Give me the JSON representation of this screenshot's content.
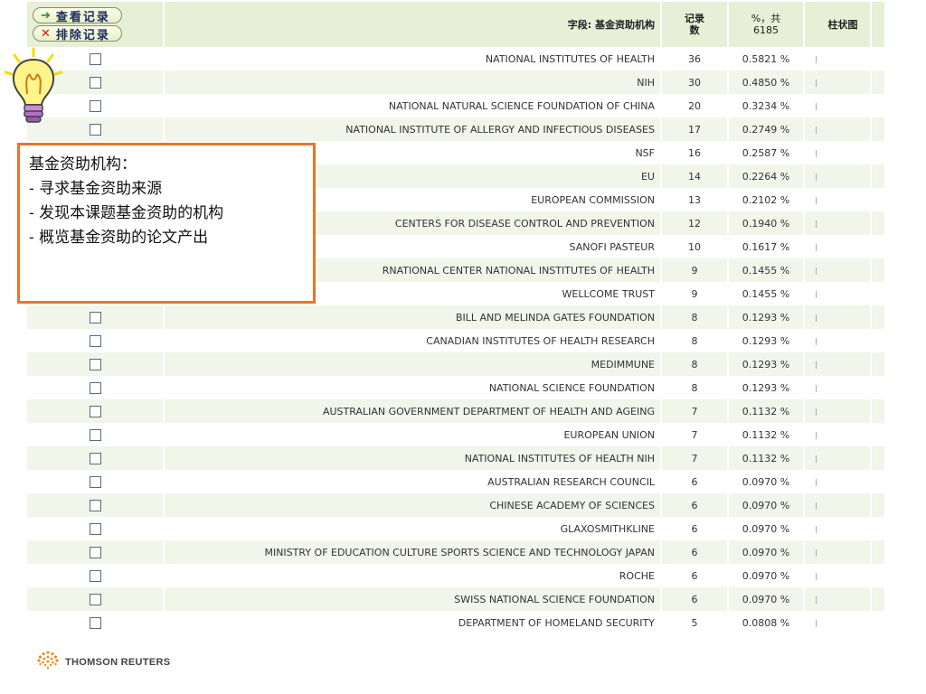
{
  "toolbar": {
    "view_records_label": "查看记录",
    "exclude_records_label": "排除记录",
    "view_icon": "arrow-right-icon",
    "exclude_icon": "x-icon"
  },
  "table": {
    "headers": {
      "field": "字段: 基金资助机构",
      "count_line1": "记录",
      "count_line2": "数",
      "percent_line1": "%，共",
      "percent_line2": "6185",
      "barchart": "柱状图"
    },
    "rows": [
      {
        "name": "NATIONAL INSTITUTES OF HEALTH",
        "count": "36",
        "percent": "0.5821 %"
      },
      {
        "name": "NIH",
        "count": "30",
        "percent": "0.4850 %"
      },
      {
        "name": "NATIONAL NATURAL SCIENCE FOUNDATION OF CHINA",
        "count": "20",
        "percent": "0.3234 %"
      },
      {
        "name": "NATIONAL INSTITUTE OF ALLERGY AND INFECTIOUS DISEASES",
        "count": "17",
        "percent": "0.2749 %"
      },
      {
        "name": "NSF",
        "count": "16",
        "percent": "0.2587 %"
      },
      {
        "name": "EU",
        "count": "14",
        "percent": "0.2264 %"
      },
      {
        "name": "EUROPEAN COMMISSION",
        "count": "13",
        "percent": "0.2102 %"
      },
      {
        "name": "CENTERS FOR DISEASE CONTROL AND PREVENTION",
        "count": "12",
        "percent": "0.1940 %"
      },
      {
        "name": "SANOFI PASTEUR",
        "count": "10",
        "percent": "0.1617 %"
      },
      {
        "name": "RNATIONAL CENTER NATIONAL INSTITUTES OF HEALTH",
        "count": "9",
        "percent": "0.1455 %"
      },
      {
        "name": "WELLCOME TRUST",
        "count": "9",
        "percent": "0.1455 %"
      },
      {
        "name": "BILL AND MELINDA GATES FOUNDATION",
        "count": "8",
        "percent": "0.1293 %"
      },
      {
        "name": "CANADIAN INSTITUTES OF HEALTH RESEARCH",
        "count": "8",
        "percent": "0.1293 %"
      },
      {
        "name": "MEDIMMUNE",
        "count": "8",
        "percent": "0.1293 %"
      },
      {
        "name": "NATIONAL SCIENCE FOUNDATION",
        "count": "8",
        "percent": "0.1293 %"
      },
      {
        "name": "AUSTRALIAN GOVERNMENT DEPARTMENT OF HEALTH AND AGEING",
        "count": "7",
        "percent": "0.1132 %"
      },
      {
        "name": "EUROPEAN UNION",
        "count": "7",
        "percent": "0.1132 %"
      },
      {
        "name": "NATIONAL INSTITUTES OF HEALTH NIH",
        "count": "7",
        "percent": "0.1132 %"
      },
      {
        "name": "AUSTRALIAN RESEARCH COUNCIL",
        "count": "6",
        "percent": "0.0970 %"
      },
      {
        "name": "CHINESE ACADEMY OF SCIENCES",
        "count": "6",
        "percent": "0.0970 %"
      },
      {
        "name": "GLAXOSMITHKLINE",
        "count": "6",
        "percent": "0.0970 %"
      },
      {
        "name": "MINISTRY OF EDUCATION CULTURE SPORTS SCIENCE AND TECHNOLOGY JAPAN",
        "count": "6",
        "percent": "0.0970 %"
      },
      {
        "name": "ROCHE",
        "count": "6",
        "percent": "0.0970 %"
      },
      {
        "name": "SWISS NATIONAL SCIENCE FOUNDATION",
        "count": "6",
        "percent": "0.0970 %"
      },
      {
        "name": "DEPARTMENT OF HOMELAND SECURITY",
        "count": "5",
        "percent": "0.0808 %"
      }
    ]
  },
  "callout": {
    "title": "基金资助机构：",
    "items": [
      "- 寻求基金资助来源",
      "- 发现本课题基金资助的机构",
      "- 概览基金资助的论文产出"
    ]
  },
  "decoration": {
    "bulb_icon": "lightbulb-icon"
  },
  "footer": {
    "brand": "THOMSON REUTERS",
    "logo_icon": "thomson-reuters-logo-icon"
  },
  "colors": {
    "accent_orange": "#e8742a",
    "header_bg": "#e7efd7",
    "row_alt": "#f1f5ea"
  }
}
